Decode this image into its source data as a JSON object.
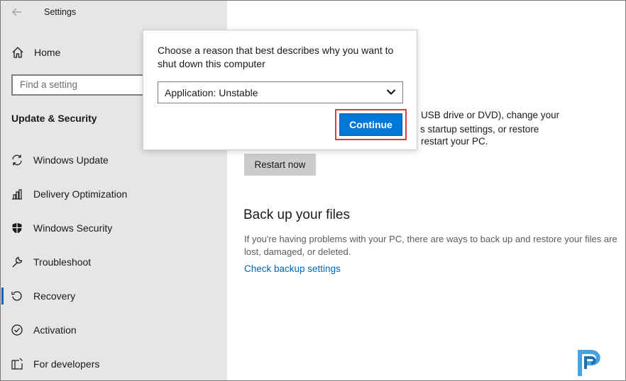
{
  "window": {
    "title": "Settings"
  },
  "sidebar": {
    "home_label": "Home",
    "search_placeholder": "Find a setting",
    "section_title": "Update & Security",
    "items": [
      {
        "label": "Windows Update",
        "icon": "sync-icon"
      },
      {
        "label": "Delivery Optimization",
        "icon": "delivery-optimization-icon"
      },
      {
        "label": "Windows Security",
        "icon": "shield-icon"
      },
      {
        "label": "Troubleshoot",
        "icon": "wrench-icon"
      },
      {
        "label": "Recovery",
        "icon": "recovery-icon",
        "selected": true
      },
      {
        "label": "Activation",
        "icon": "check-circle-icon"
      },
      {
        "label": "For developers",
        "icon": "developer-icon"
      }
    ]
  },
  "main": {
    "partial_lines": [
      "USB drive or DVD), change your",
      "s startup settings, or restore",
      "restart your PC."
    ],
    "restart_button": "Restart now",
    "backup_heading": "Back up your files",
    "backup_description": "If you're having problems with your PC, there are ways to back up and restore your files are lost, damaged, or deleted.",
    "backup_link": "Check backup settings"
  },
  "dialog": {
    "prompt": "Choose a reason that best describes why you want to shut down this computer",
    "selected_reason": "Application: Unstable",
    "continue_label": "Continue"
  },
  "colors": {
    "sidebar_bg": "#e6e6e6",
    "accent": "#0078d7",
    "link": "#0067b8",
    "highlight": "#e0393e"
  }
}
